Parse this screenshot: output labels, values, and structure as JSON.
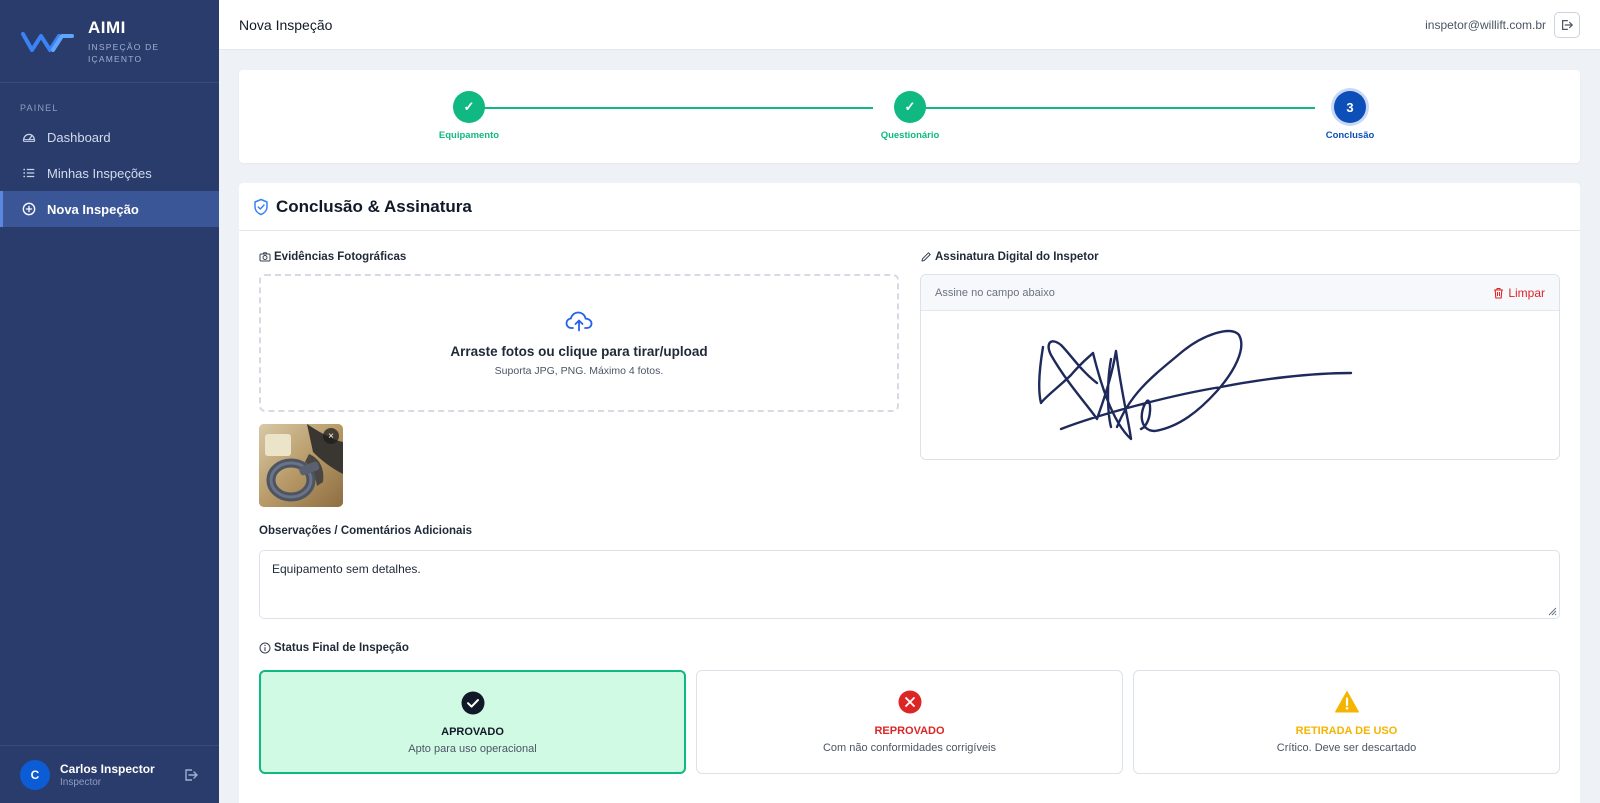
{
  "brand": {
    "name": "AIMI",
    "subtitle": "INSPEÇÃO DE IÇAMENTO",
    "accent": "#3b82f6"
  },
  "sidebar": {
    "section_label": "PAINEL",
    "items": [
      {
        "label": "Dashboard",
        "icon": "gauge-icon",
        "active": false
      },
      {
        "label": "Minhas Inspeções",
        "icon": "list-icon",
        "active": false
      },
      {
        "label": "Nova Inspeção",
        "icon": "plus-circle-icon",
        "active": true
      }
    ],
    "user": {
      "initial": "C",
      "name": "Carlos Inspector",
      "role": "Inspector"
    }
  },
  "header": {
    "title": "Nova Inspeção",
    "email": "inspetor@willift.com.br"
  },
  "stepper": {
    "steps": [
      {
        "label": "Equipamento",
        "state": "done",
        "symbol": "✓"
      },
      {
        "label": "Questionário",
        "state": "done",
        "symbol": "✓"
      },
      {
        "label": "Conclusão",
        "state": "current",
        "symbol": "3"
      }
    ],
    "done_color": "#10b981",
    "current_color": "#0d4fb8"
  },
  "card": {
    "title": "Conclusão & Assinatura",
    "photos": {
      "label": "Evidências Fotográficas",
      "drop_title": "Arraste fotos ou clique para tirar/upload",
      "drop_sub": "Suporta JPG, PNG. Máximo 4 fotos.",
      "remove_symbol": "×"
    },
    "signature": {
      "label": "Assinatura Digital do Inspetor",
      "hint": "Assine no campo abaixo",
      "clear_label": "Limpar"
    },
    "observations": {
      "label": "Observações / Comentários Adicionais",
      "value": "Equipamento sem detalhes."
    },
    "status": {
      "label": "Status Final de Inspeção",
      "options": [
        {
          "title": "APROVADO",
          "desc": "Apto para uso operacional",
          "color": "#111827",
          "icon": "check-circle-icon",
          "selected": true
        },
        {
          "title": "REPROVADO",
          "desc": "Com não conformidades corrigíveis",
          "color": "#dc2626",
          "icon": "x-circle-icon",
          "selected": false
        },
        {
          "title": "RETIRADA DE USO",
          "desc": "Crítico. Deve ser descartado",
          "color": "#f5b400",
          "icon": "warning-triangle-icon",
          "selected": false
        }
      ]
    }
  }
}
